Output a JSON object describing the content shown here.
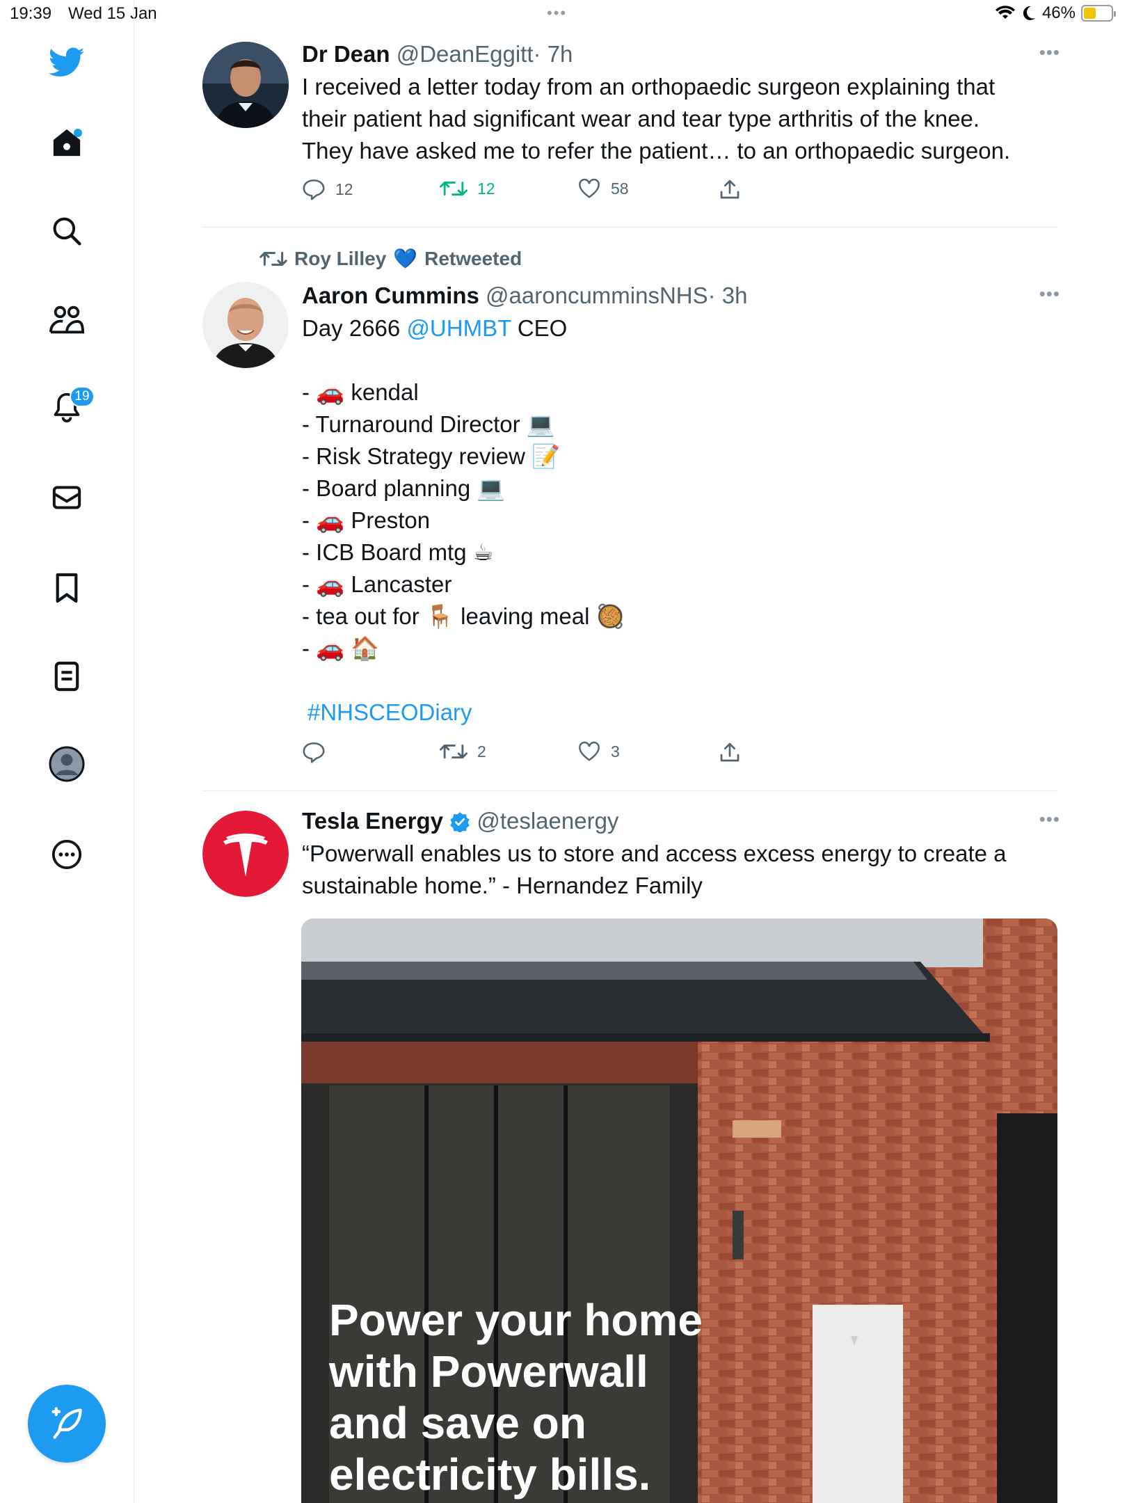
{
  "status_bar": {
    "time": "19:39",
    "date": "Wed 15 Jan",
    "battery": "46%"
  },
  "sidebar": {
    "notifications_badge": "19"
  },
  "tweets": [
    {
      "name": "Dr Dean",
      "handle": "@DeanEggitt",
      "time": "· 7h",
      "lines": [
        "I received a letter today from an orthopaedic surgeon explaining that",
        "their patient had significant wear and tear type arthritis of the knee.",
        "They have asked me to refer the patient… to an orthopaedic surgeon."
      ],
      "replies": "12",
      "retweets": "12",
      "likes": "58"
    },
    {
      "social_context": "Roy Lilley",
      "social_emoji": "💙",
      "social_action": "Retweeted",
      "name": "Aaron Cummins",
      "handle": "@aaroncumminsNHS",
      "time": "· 3h",
      "line1_prefix": "Day 2666",
      "line1_mention": "@UHMBT",
      "line1_suffix": "CEO",
      "lines": [
        "- 🚗 kendal",
        "- Turnaround Director 💻",
        "- Risk Strategy review 📝",
        "- Board planning 💻",
        "- 🚗 Preston",
        "- ICB Board mtg ☕",
        "- 🚗 Lancaster",
        "- tea out for 🪑 leaving meal 🥘",
        "- 🚗 🏠"
      ],
      "hashtag": "#NHSCEODiary",
      "replies": "",
      "retweets": "2",
      "likes": "3"
    },
    {
      "name": "Tesla Energy",
      "handle": "@teslaenergy",
      "lines": [
        "“Powerwall enables us to store and access excess energy to create a",
        "sustainable home.” - Hernandez Family"
      ],
      "media_text": [
        "Power your home",
        "with Powerwall",
        "and save on",
        "electricity bills."
      ]
    }
  ],
  "colors": {
    "accent": "#1d9bf0",
    "retweet_green": "#00ba7c",
    "tesla_red": "#e31937"
  }
}
